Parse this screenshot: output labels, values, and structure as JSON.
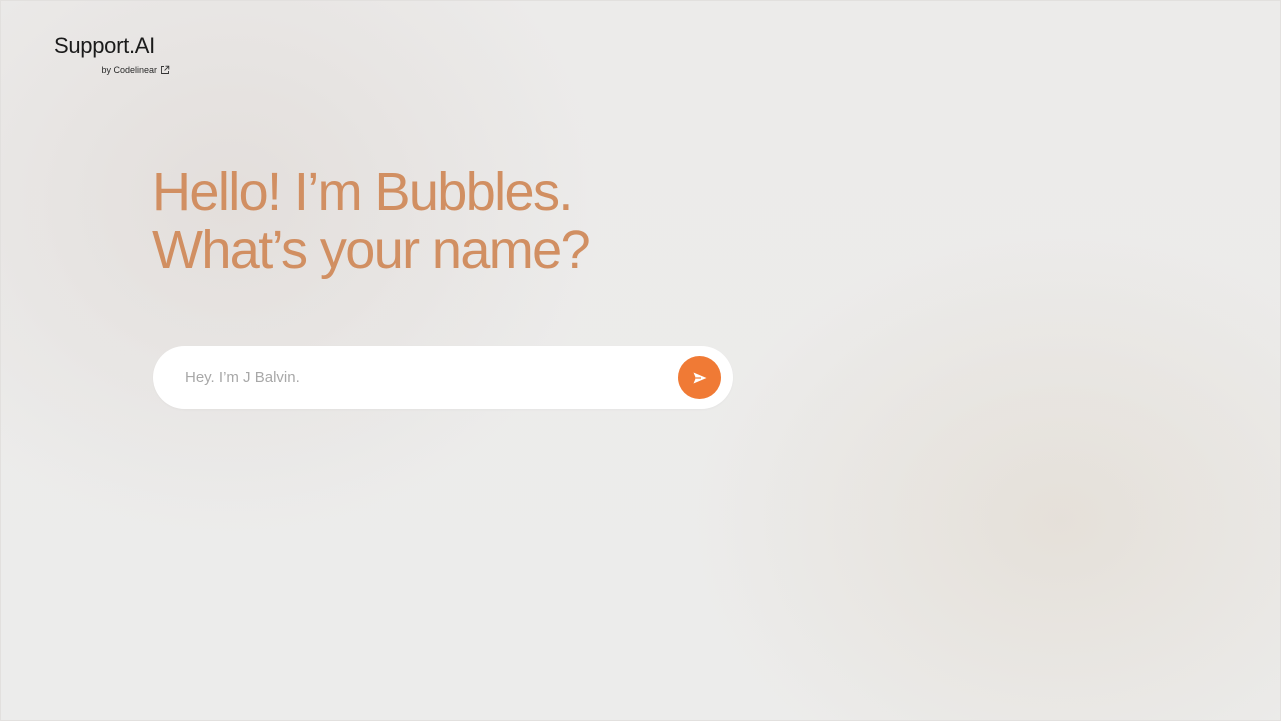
{
  "brand": {
    "name": "Support.AI",
    "byline": "by Codelinear",
    "byline_icon": "external-link-icon"
  },
  "headline": {
    "line1": "Hello! I’m Bubbles.",
    "line2": "What’s your name?"
  },
  "composer": {
    "placeholder": "Hey. I’m J Balvin.",
    "value": "",
    "send_icon": "send-icon"
  },
  "colors": {
    "accent": "#f07a35",
    "headline": "#d18f62",
    "background": "#ecebea",
    "input_background": "#ffffff"
  }
}
